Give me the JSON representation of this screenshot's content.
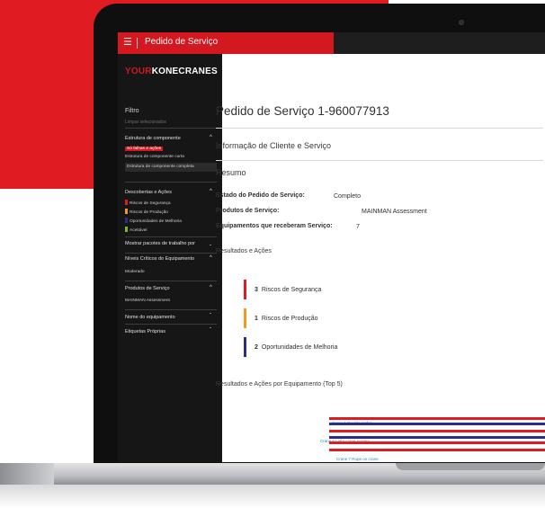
{
  "app": {
    "window_title": "Pedido de Serviço",
    "logo_prefix": "YOUR",
    "logo_brand": "KONECRANES"
  },
  "sidebar": {
    "filter_title": "Filtro",
    "filter_subtitle": "Limpar selecionados",
    "sections": [
      {
        "label": "Estrutura de componente",
        "items": [
          "Só falhas e ações",
          "Estrutura de componente curta",
          "Estrutura de componente completa"
        ]
      },
      {
        "label": "Descobertas e Ações",
        "items": [
          "Riscos de Segurança",
          "Riscos de Produção",
          "Oportunidades de Melhoria",
          "Aceitável"
        ]
      },
      {
        "label": "Mostrar pacotes de trabalho por"
      },
      {
        "label": "Níveis Críticos do Equipamento",
        "items": [
          "Moderado"
        ]
      },
      {
        "label": "Produtos de Serviço",
        "items": [
          "MAINMAN Assessment"
        ]
      },
      {
        "label": "Nome do equipamento"
      },
      {
        "label": "Etiquetas Próprias"
      }
    ]
  },
  "main": {
    "title": "Pedido de Serviço 1-960077913",
    "subtitle": "Informação de Cliente e Serviço",
    "summary_title": "Resumo",
    "fields": [
      {
        "label": "Estado do Pedido de Serviço:",
        "value": "Completo"
      },
      {
        "label": "Produtos de Serviço:",
        "value": "MAINMAN Assessment"
      },
      {
        "label": "Equipamentos que receberam Serviço:",
        "value": "7"
      }
    ],
    "results_title": "Resultados e Ações",
    "results": [
      {
        "count": "3",
        "label": "Riscos de Segurança",
        "color": "#e01b22"
      },
      {
        "count": "1",
        "label": "Riscos de Produção",
        "color": "#f39a1e"
      },
      {
        "count": "2",
        "label": "Oportunidades de Melhoria",
        "color": "#2b2d8c"
      }
    ],
    "equipment_title": "Resultados e Ações por Equipamento (Top 5)",
    "equipment": [
      "Crane 1 Double girder",
      "Crane 6 Light crane system",
      "Crane 7 Rope on crane"
    ]
  },
  "colors": {
    "brand_red": "#e01b22",
    "safety": "#e01b22",
    "production": "#f39a1e",
    "improvement": "#2b2d8c",
    "acceptable": "#7ab929"
  }
}
